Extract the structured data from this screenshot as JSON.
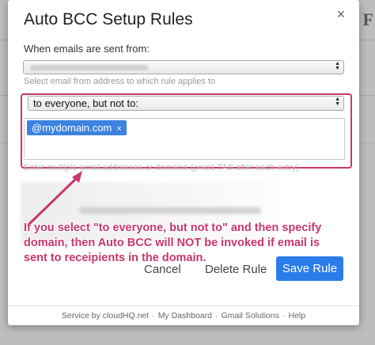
{
  "dialog": {
    "title": "Auto BCC Setup Rules",
    "close_label": "×"
  },
  "from": {
    "label": "When emails are sent from:",
    "hint": "Select email from address to which rule applies to"
  },
  "rule": {
    "mode_value": "to everyone, but not to:",
    "tag_text": "@mydomain.com",
    "tag_remove": "×",
    "hint": "Enter multiple email addresses or domains (press TAB after each entry)"
  },
  "annotation": {
    "text": "If you select \"to everyone, but not to\" and then specify domain, then Auto BCC will NOT be invoked if email is sent to receipients in the domain."
  },
  "actions": {
    "cancel": "Cancel",
    "delete": "Delete Rule",
    "save": "Save Rule"
  },
  "footer": {
    "service": "Service by cloudHQ.net",
    "dashboard": "My Dashboard",
    "gmail": "Gmail Solutions",
    "help": "Help",
    "separator": "·"
  },
  "colors": {
    "accent": "#2b7de9",
    "tag": "#3c82e0",
    "annotation": "#c9366b"
  }
}
